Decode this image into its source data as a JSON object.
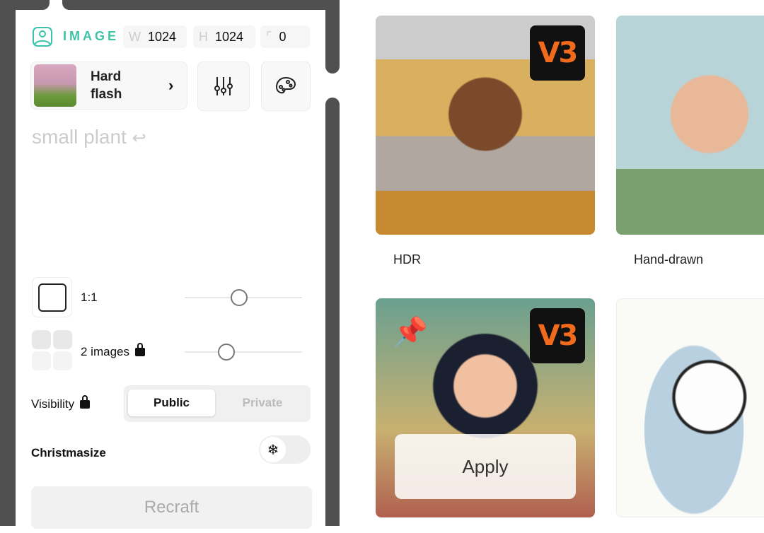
{
  "header": {
    "mode": "IMAGE",
    "width_key": "W",
    "width": "1024",
    "height_key": "H",
    "height": "1024",
    "corner": "0"
  },
  "style": {
    "name_line1": "Hard",
    "name_line2": "flash"
  },
  "prompt": {
    "placeholder": "small plant"
  },
  "aspect": {
    "label": "1:1",
    "slider_value": 0.46
  },
  "count": {
    "label": "2 images",
    "slider_value": 0.35
  },
  "visibility": {
    "label": "Visibility",
    "options": [
      "Public",
      "Private"
    ],
    "selected": "Public"
  },
  "christmasize": {
    "label": "Christmasize",
    "enabled": false
  },
  "recraft_label": "Recraft",
  "gallery": [
    {
      "label": "HDR",
      "badge": "V3"
    },
    {
      "label": "Hand-drawn"
    },
    {
      "label": "",
      "badge": "V3",
      "pinned": true,
      "action": "Apply"
    },
    {
      "label": ""
    }
  ],
  "colors": {
    "accent": "#3cc4a8",
    "badge": "#f26a1b",
    "frame": "#505050"
  }
}
